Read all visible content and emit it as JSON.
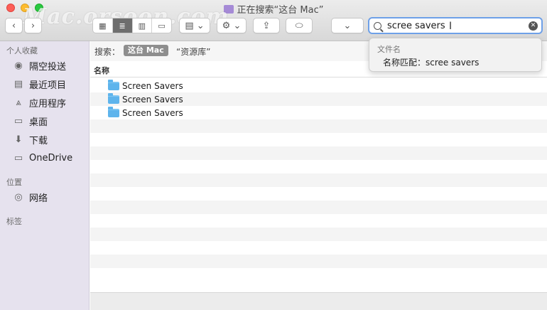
{
  "window": {
    "title": "正在搜索“这台 Mac”",
    "watermark": "Mac.orsoon.com"
  },
  "toolbar": {
    "back_icon": "chevron-left-icon",
    "forward_icon": "chevron-right-icon",
    "view_modes": [
      "icon-view",
      "list-view",
      "column-view",
      "gallery-view"
    ],
    "active_view": "list-view"
  },
  "search": {
    "value": "scree savers"
  },
  "suggestions": {
    "heading": "文件名",
    "item": "名称匹配：scree savers"
  },
  "sidebar": {
    "favorites_heading": "个人收藏",
    "favorites": [
      {
        "label": "隔空投送",
        "icon": "airdrop-icon"
      },
      {
        "label": "最近项目",
        "icon": "recents-icon"
      },
      {
        "label": "应用程序",
        "icon": "applications-icon"
      },
      {
        "label": "桌面",
        "icon": "desktop-icon"
      },
      {
        "label": "下载",
        "icon": "downloads-icon"
      },
      {
        "label": "OneDrive",
        "icon": "folder-icon"
      }
    ],
    "locations_heading": "位置",
    "locations": [
      {
        "label": "网络",
        "icon": "network-icon"
      }
    ],
    "tags_heading": "标签"
  },
  "scope": {
    "label": "搜索：",
    "active": "这台 Mac",
    "other": "“资源库”"
  },
  "list": {
    "column_name": "名称",
    "items": [
      {
        "name": "Screen Savers"
      },
      {
        "name": "Screen Savers"
      },
      {
        "name": "Screen Savers"
      }
    ]
  }
}
